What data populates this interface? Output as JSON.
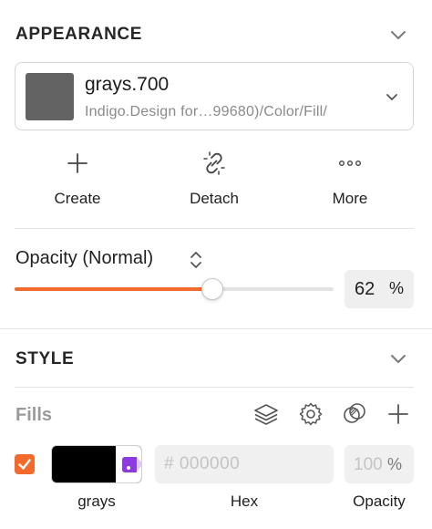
{
  "appearance": {
    "title": "APPEARANCE",
    "color": {
      "name": "grays.700",
      "path": "Indigo.Design for…99680)/Color/Fill/",
      "swatch_color": "#636363"
    },
    "actions": [
      {
        "label": "Create",
        "icon": "plus-icon"
      },
      {
        "label": "Detach",
        "icon": "unlink-icon"
      },
      {
        "label": "More",
        "icon": "more-icon"
      }
    ]
  },
  "opacity": {
    "label": "Opacity (Normal)",
    "value": "62",
    "unit": "%",
    "fraction": 0.62,
    "accent": "#f26a2c"
  },
  "style": {
    "title": "STYLE",
    "fills": {
      "label": "Fills",
      "icons": [
        "layers-icon",
        "gear-icon",
        "blend-icon",
        "plus-icon"
      ],
      "row": {
        "checked": true,
        "swatch_color": "#000000",
        "hex_placeholder": "# 000000",
        "opacity_placeholder": "100",
        "opacity_unit": "%",
        "captions": {
          "swatch": "grays",
          "hex": "Hex",
          "opacity": "Opacity"
        }
      }
    }
  }
}
